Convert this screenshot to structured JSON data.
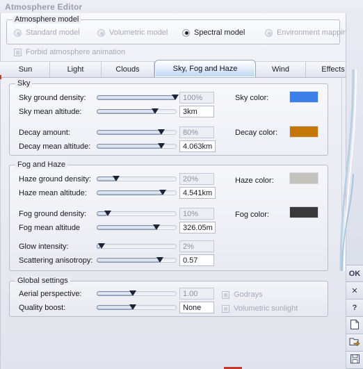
{
  "window": {
    "title": "Atmosphere Editor"
  },
  "atmosphere_model": {
    "legend": "Atmosphere model",
    "options": [
      {
        "label": "Standard model",
        "selected": false,
        "enabled": false
      },
      {
        "label": "Volumetric model",
        "selected": false,
        "enabled": false
      },
      {
        "label": "Spectral model",
        "selected": true,
        "enabled": true
      },
      {
        "label": "Environment mapping",
        "selected": false,
        "enabled": false
      }
    ]
  },
  "forbid_animation": {
    "label": "Forbid atmosphere animation",
    "checked": false,
    "enabled": false
  },
  "tabs": {
    "active": "Sky, Fog and Haze",
    "items": [
      {
        "label": "Sun"
      },
      {
        "label": "Light"
      },
      {
        "label": "Clouds"
      },
      {
        "label": "Sky, Fog and Haze"
      },
      {
        "label": "Wind"
      },
      {
        "label": "Effects"
      }
    ]
  },
  "sky": {
    "legend": "Sky",
    "rows": [
      {
        "label": "Sky ground density:",
        "value": "100%",
        "fill_pct": 99,
        "editable": false
      },
      {
        "label": "Sky mean altitude:",
        "value": "3km",
        "fill_pct": 73,
        "editable": true
      },
      {
        "label": "Decay amount:",
        "value": "80%",
        "fill_pct": 81,
        "editable": false
      },
      {
        "label": "Decay mean altitude:",
        "value": "4.063km",
        "fill_pct": 81,
        "editable": true
      }
    ],
    "colors": [
      {
        "label": "Sky color:",
        "hex": "#3d7fe8"
      },
      {
        "label": "Decay color:",
        "hex": "#c27708"
      }
    ]
  },
  "fog_and_haze": {
    "legend": "Fog and Haze",
    "rows": [
      {
        "label": "Haze ground density:",
        "value": "20%",
        "fill_pct": 24,
        "editable": false
      },
      {
        "label": "Haze mean altitude:",
        "value": "4.541km",
        "fill_pct": 83,
        "editable": true
      },
      {
        "label": "Fog ground density:",
        "value": "10%",
        "fill_pct": 13,
        "editable": false
      },
      {
        "label": "Fog mean altitude",
        "value": "326.05m",
        "fill_pct": 75,
        "editable": true
      },
      {
        "label": "Glow intensity:",
        "value": "2%",
        "fill_pct": 4,
        "editable": false
      },
      {
        "label": "Scattering anisotropy:",
        "value": "0.57",
        "fill_pct": 79,
        "editable": true
      }
    ],
    "colors": [
      {
        "label": "Haze color:",
        "hex": "#c3c2bc"
      },
      {
        "label": "Fog color:",
        "hex": "#383838"
      }
    ]
  },
  "global_settings": {
    "legend": "Global settings",
    "rows": [
      {
        "label": "Aerial perspective:",
        "value": "1.00",
        "fill_pct": 45,
        "editable": false
      },
      {
        "label": "Quality boost:",
        "value": "None",
        "fill_pct": 45,
        "editable": true
      }
    ],
    "checks": [
      {
        "label": "Godrays",
        "checked": false,
        "enabled": false
      },
      {
        "label": "Volumetric sunlight",
        "checked": false,
        "enabled": false
      }
    ]
  },
  "rail_buttons": [
    {
      "name": "ok-button",
      "label": "OK",
      "icon": "ok"
    },
    {
      "name": "cancel-button",
      "label": "✕",
      "icon": "close"
    },
    {
      "name": "help-button",
      "label": "?",
      "icon": "help"
    },
    {
      "name": "new-button",
      "label": "",
      "icon": "new-file"
    },
    {
      "name": "open-button",
      "label": "",
      "icon": "open-folder"
    },
    {
      "name": "save-button",
      "label": "",
      "icon": "floppy-disk"
    }
  ]
}
